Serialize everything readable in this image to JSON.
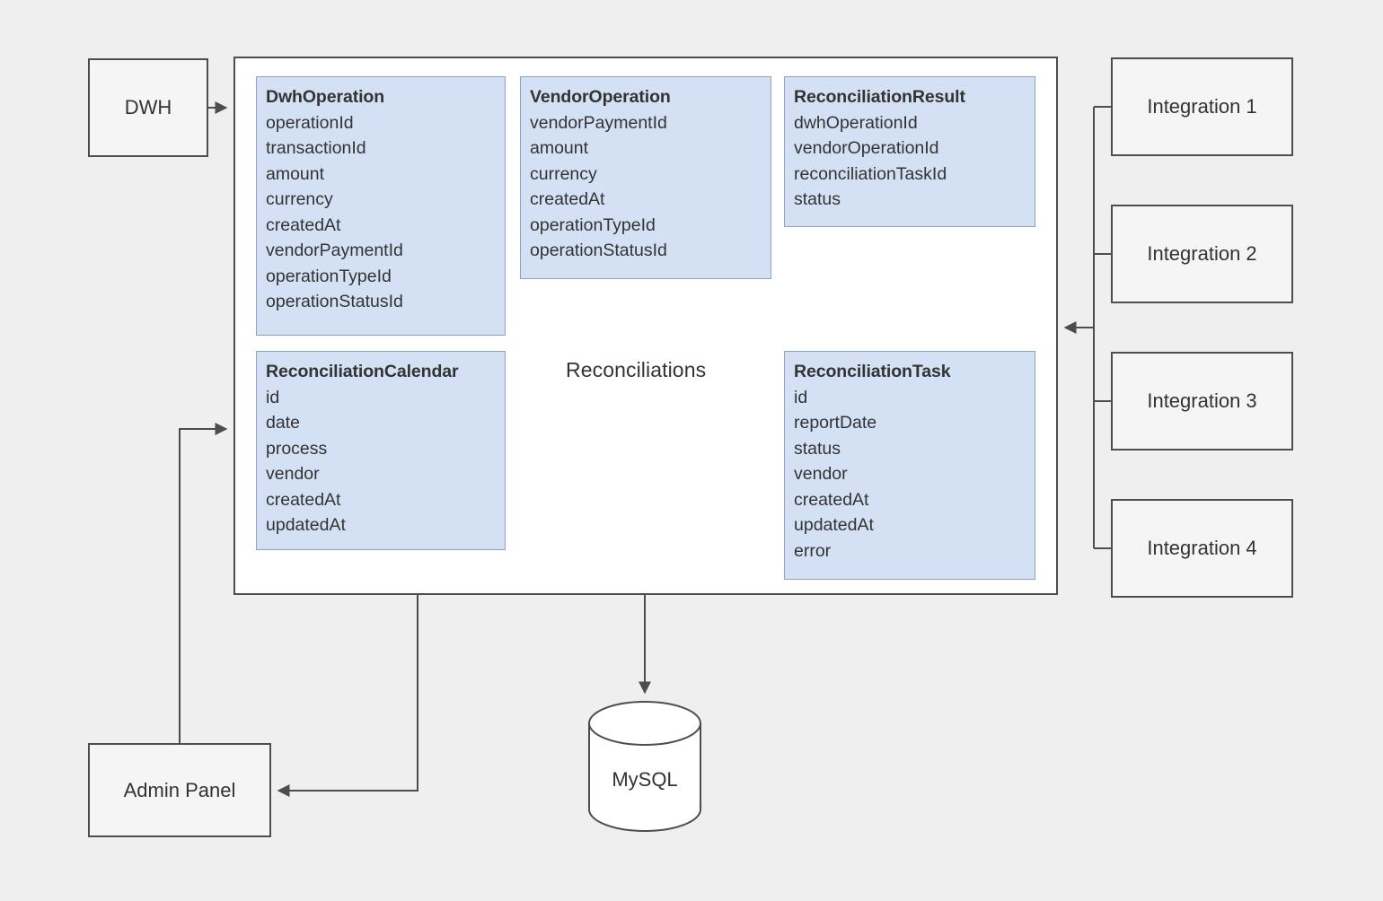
{
  "diagram": {
    "title": "Reconciliations",
    "background_color": "#efefef",
    "entity_fill": "#d4e1f5",
    "entity_border": "#8ea2bf",
    "external_fill": "#f5f5f5",
    "stroke_color": "#4d4d4d",
    "text_color": "#333333"
  },
  "service": {
    "label": "Reconciliations",
    "entities": [
      {
        "name": "DwhOperation",
        "fields": [
          "operationId",
          "transactionId",
          "amount",
          "currency",
          "createdAt",
          "vendorPaymentId",
          "operationTypeId",
          "operationStatusId"
        ]
      },
      {
        "name": "VendorOperation",
        "fields": [
          "vendorPaymentId",
          "amount",
          "currency",
          "createdAt",
          "operationTypeId",
          "operationStatusId"
        ]
      },
      {
        "name": "ReconciliationResult",
        "fields": [
          "dwhOperationId",
          "vendorOperationId",
          "reconciliationTaskId",
          "status"
        ]
      },
      {
        "name": "ReconciliationCalendar",
        "fields": [
          "id",
          "date",
          "process",
          "vendor",
          "createdAt",
          "updatedAt"
        ]
      },
      {
        "name": "ReconciliationTask",
        "fields": [
          "id",
          "reportDate",
          "status",
          "vendor",
          "createdAt",
          "updatedAt",
          "error"
        ]
      }
    ]
  },
  "externals": {
    "dwh": {
      "label": "DWH"
    },
    "admin_panel": {
      "label": "Admin Panel"
    },
    "integrations": [
      {
        "label": "Integration 1"
      },
      {
        "label": "Integration 2"
      },
      {
        "label": "Integration 3"
      },
      {
        "label": "Integration 4"
      }
    ]
  },
  "datastore": {
    "label": "MySQL",
    "shape": "cylinder-icon"
  },
  "connections": [
    {
      "from": "DWH",
      "to": "Reconciliations",
      "direction": "right"
    },
    {
      "from": "Integration 1",
      "to": "Reconciliations",
      "direction": "left"
    },
    {
      "from": "Integration 2",
      "to": "Reconciliations",
      "direction": "left"
    },
    {
      "from": "Integration 3",
      "to": "Reconciliations",
      "direction": "left"
    },
    {
      "from": "Integration 4",
      "to": "Reconciliations",
      "direction": "left"
    },
    {
      "from": "Admin Panel",
      "to": "Reconciliations",
      "direction": "right"
    },
    {
      "from": "Reconciliations",
      "to": "Admin Panel",
      "direction": "left"
    },
    {
      "from": "Reconciliations",
      "to": "MySQL",
      "direction": "down"
    }
  ]
}
